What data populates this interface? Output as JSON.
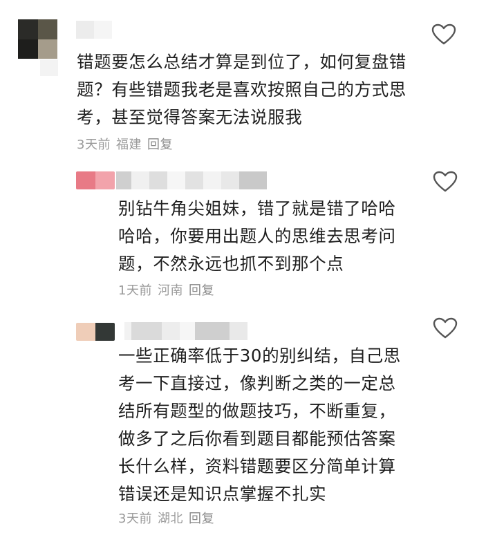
{
  "comments": [
    {
      "text": "错题要怎么总结才算是到位了，如何复盘错\n题？有些错题我老是喜欢按照自己的方式思\n考，甚至觉得答案无法说服我",
      "time": "3天前",
      "location": "福建",
      "reply_label": "回复"
    },
    {
      "text": "别钻牛角尖姐妹，错了就是错了哈哈\n哈哈，你要用出题人的思维去思考问\n题，不然永远也抓不到那个点",
      "time": "1天前",
      "location": "河南",
      "reply_label": "回复"
    },
    {
      "text": "一些正确率低于30的别纠结，自己思\n考一下直接过，像判断之类的一定总\n结所有题型的做题技巧，不断重复，\n做多了之后你看到题目都能预估答案\n长什么样，资料错题要区分简单计算\n错误还是知识点掌握不扎实",
      "time": "3天前",
      "location": "湖北",
      "reply_label": "回复"
    }
  ],
  "icons": {
    "like": "heart-outline-icon"
  },
  "colors": {
    "text": "#1e1e1e",
    "meta": "#9a9a9a",
    "icon": "#555555",
    "background": "#ffffff"
  }
}
